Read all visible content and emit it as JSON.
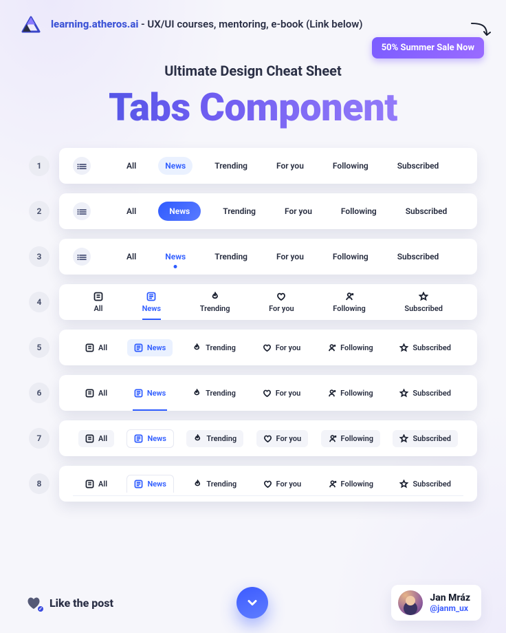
{
  "header": {
    "site_link": "learning.atheros.ai",
    "tagline": " - UX/UI courses, mentoring, e-book (Link below)",
    "sale_badge": "50% Summer Sale Now"
  },
  "titles": {
    "subtitle": "Ultimate Design Cheat Sheet",
    "title": "Tabs Component"
  },
  "tabs": {
    "labels": [
      "All",
      "News",
      "Trending",
      "For you",
      "Following",
      "Subscribed"
    ],
    "active_index": 1
  },
  "rows": [
    "1",
    "2",
    "3",
    "4",
    "5",
    "6",
    "7",
    "8"
  ],
  "footer": {
    "like_label": "Like the post",
    "author_name": "Jan Mráz",
    "author_handle": "@janm_ux"
  }
}
